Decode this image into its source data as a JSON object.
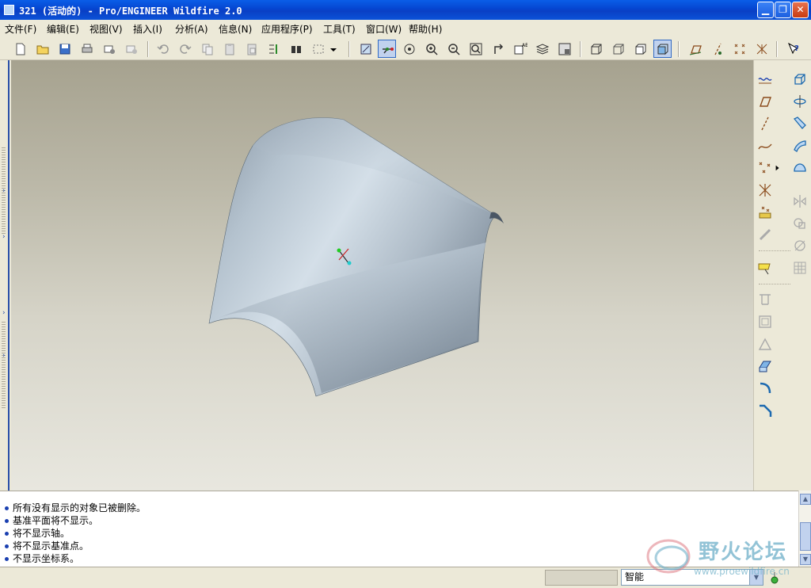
{
  "window": {
    "title": "321 (活动的) - Pro/ENGINEER Wildfire 2.0"
  },
  "menu": {
    "items": [
      "文件(F)",
      "编辑(E)",
      "视图(V)",
      "插入(I)",
      "分析(A)",
      "信息(N)",
      "应用程序(P)",
      "工具(T)",
      "窗口(W)",
      "帮助(H)"
    ]
  },
  "messages": [
    "所有没有显示的对象已被删除。",
    "基准平面将不显示。",
    "将不显示轴。",
    "将不显示基准点。",
    "不显示坐标系。"
  ],
  "status": {
    "filter_value": "智能"
  },
  "watermark": {
    "name": "野火论坛",
    "url": "www.proewildfire.cn"
  },
  "colors": {
    "title_bar": "#0a4fd6",
    "surface": "#b8c4ce",
    "background_top": "#a6a28f",
    "background_bottom": "#e8e7df"
  }
}
